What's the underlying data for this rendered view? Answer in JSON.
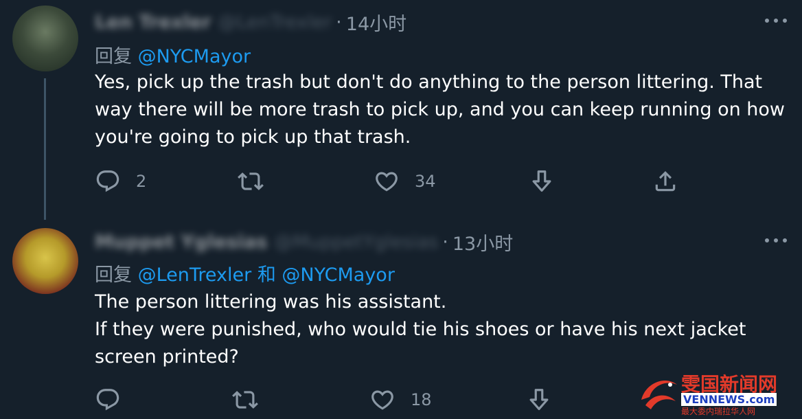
{
  "tweets": [
    {
      "author_name": "Len Trexler",
      "author_handle": "@LenTrexler",
      "time": "14小时",
      "reply_prefix": "回复 ",
      "reply_mention1": "@NYCMayor",
      "reply_joiner": "",
      "reply_mention2": "",
      "body_lines": [
        "Yes, pick up the trash but don't do anything to the person littering. That",
        "way there will be more trash to pick up, and you can keep running on how",
        "you're going to pick up that trash."
      ],
      "replies": "2",
      "retweets": "",
      "likes": "34"
    },
    {
      "author_name": "Muppet Yglesias",
      "author_handle": "@MuppetYglesias",
      "time": "13小时",
      "reply_prefix": "回复 ",
      "reply_mention1": "@LenTrexler",
      "reply_joiner": " 和 ",
      "reply_mention2": "@NYCMayor",
      "body_lines": [
        "The person littering was his assistant.",
        "If they were punished, who would tie his shoes or have his next jacket",
        "screen printed?"
      ],
      "replies": "",
      "retweets": "",
      "likes": "18"
    }
  ],
  "separator": "·",
  "icons": {
    "reply": "reply-icon",
    "retweet": "retweet-icon",
    "like": "heart-icon",
    "downvote": "downvote-icon",
    "share": "share-icon",
    "more": "more-icon"
  },
  "watermark": {
    "title": "雯国新闻网",
    "url": "VENNEWS.com",
    "subtitle": "最大委内瑞拉华人网"
  },
  "colors": {
    "background": "#15202b",
    "accent": "#1d9bf0",
    "muted": "#8b98a5"
  }
}
